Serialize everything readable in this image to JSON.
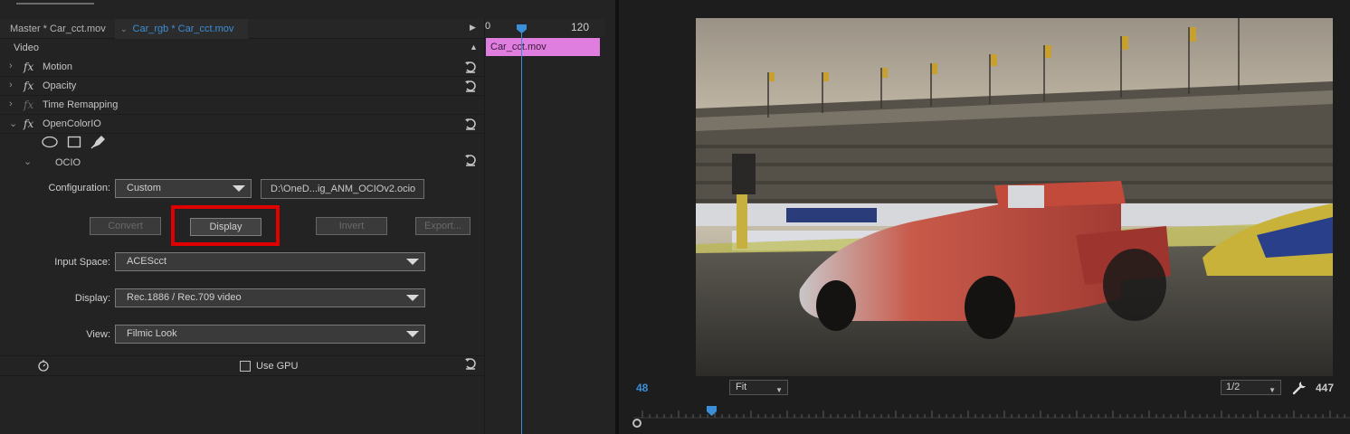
{
  "tabs": {
    "master": "Master * Car_cct.mov",
    "clip": "Car_rgb * Car_cct.mov"
  },
  "section": {
    "video": "Video"
  },
  "effects": [
    {
      "label": "Motion"
    },
    {
      "label": "Opacity"
    },
    {
      "label": "Time Remapping"
    },
    {
      "label": "OpenColorIO"
    }
  ],
  "ocio": {
    "group_label": "OCIO",
    "configuration_label": "Configuration:",
    "configuration_value": "Custom",
    "config_path": "D:\\OneD...ig_ANM_OCIOv2.ocio",
    "buttons": {
      "convert": "Convert",
      "display": "Display",
      "invert": "Invert",
      "export": "Export..."
    },
    "input_space_label": "Input Space:",
    "input_space_value": "ACEScct",
    "display_label": "Display:",
    "display_value": "Rec.1886 / Rec.709 video",
    "view_label": "View:",
    "view_value": "Filmic Look",
    "use_gpu_label": "Use GPU",
    "use_gpu_checked": false
  },
  "timeline": {
    "tick_zero": "0",
    "tick_120": "120",
    "clip_name": "Car_cct.mov"
  },
  "monitor": {
    "current_time": "48",
    "zoom": "Fit",
    "resolution": "1/2",
    "duration": "447"
  },
  "colors": {
    "accent_blue": "#3b8ed8",
    "clip_pink": "#e07ee0",
    "highlight_red": "#e00000"
  },
  "icons": [
    "chevron-right-icon",
    "fx-icon",
    "reset-icon",
    "ellipse-mask-icon",
    "rectangle-mask-icon",
    "pen-mask-icon",
    "stopwatch-icon",
    "wrench-icon"
  ]
}
